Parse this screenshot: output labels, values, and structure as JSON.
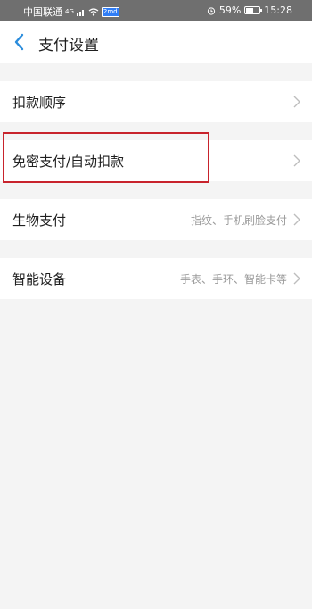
{
  "status_bar": {
    "carrier": "中国联通",
    "signal_label": "4G",
    "net_badge": "2md",
    "alarm_icon": "alarm-icon",
    "battery_percent": "59%",
    "battery_level": 0.59,
    "time": "15:28"
  },
  "header": {
    "back_icon": "chevron-left-icon",
    "title": "支付设置"
  },
  "rows": [
    {
      "label": "扣款顺序",
      "value": ""
    },
    {
      "label": "免密支付/自动扣款",
      "value": ""
    },
    {
      "label": "生物支付",
      "value": "指纹、手机刷脸支付"
    },
    {
      "label": "智能设备",
      "value": "手表、手环、智能卡等"
    }
  ],
  "colors": {
    "accent": "#2a8cdc",
    "highlight": "#c8232c",
    "background": "#f4f4f4"
  }
}
